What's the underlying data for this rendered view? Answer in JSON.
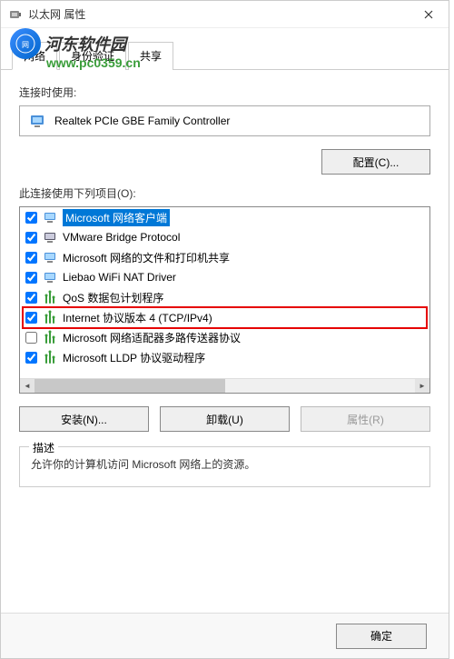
{
  "window": {
    "title": "以太网 属性"
  },
  "watermark": {
    "name": "河东软件园",
    "url": "www.pc0359.cn"
  },
  "tabs": {
    "networking": "网络",
    "auth": "身份验证",
    "sharing": "共享"
  },
  "labels": {
    "connect_using": "连接时使用:",
    "items_used": "此连接使用下列项目(O):",
    "description_title": "描述",
    "description_text": "允许你的计算机访问 Microsoft 网络上的资源。"
  },
  "device": {
    "name": "Realtek PCIe GBE Family Controller"
  },
  "buttons": {
    "configure": "配置(C)...",
    "install": "安装(N)...",
    "uninstall": "卸载(U)",
    "properties": "属性(R)",
    "ok": "确定"
  },
  "items": [
    {
      "checked": true,
      "icon": "client",
      "label": "Microsoft 网络客户端",
      "selected": true
    },
    {
      "checked": true,
      "icon": "bridge",
      "label": "VMware Bridge Protocol",
      "selected": false
    },
    {
      "checked": true,
      "icon": "service",
      "label": "Microsoft 网络的文件和打印机共享",
      "selected": false
    },
    {
      "checked": true,
      "icon": "driver",
      "label": "Liebao WiFi NAT Driver",
      "selected": false
    },
    {
      "checked": true,
      "icon": "protocol",
      "label": "QoS 数据包计划程序",
      "selected": false
    },
    {
      "checked": true,
      "icon": "protocol",
      "label": "Internet 协议版本 4 (TCP/IPv4)",
      "selected": false,
      "highlighted": true
    },
    {
      "checked": false,
      "icon": "protocol",
      "label": "Microsoft 网络适配器多路传送器协议",
      "selected": false
    },
    {
      "checked": true,
      "icon": "protocol",
      "label": "Microsoft LLDP 协议驱动程序",
      "selected": false
    }
  ]
}
